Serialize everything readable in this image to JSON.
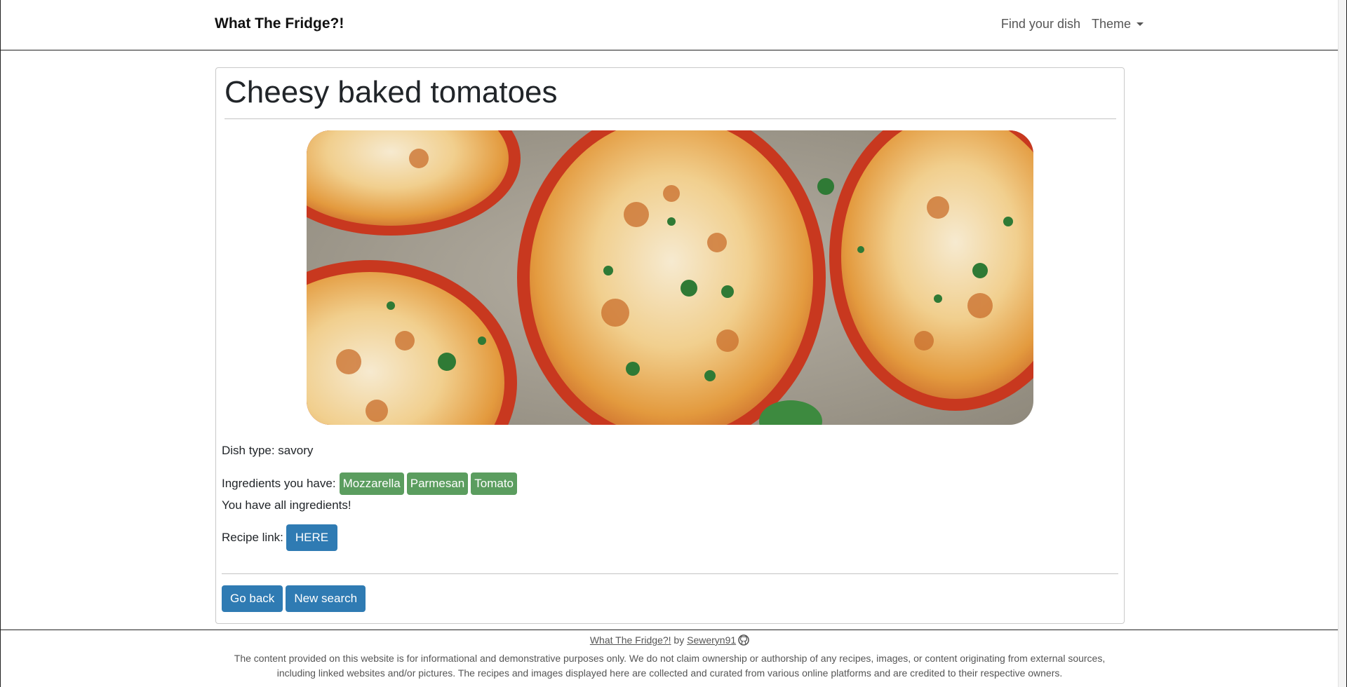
{
  "navbar": {
    "brand": "What The Fridge?!",
    "links": {
      "find": "Find your dish",
      "theme": "Theme"
    }
  },
  "recipe": {
    "title": "Cheesy baked tomatoes",
    "image_alt": "Cheesy baked tomatoes",
    "dish_type": "Dish type: savory",
    "ingredients_label": "Ingredients you have:",
    "ingredients": [
      "Mozzarella",
      "Parmesan",
      "Tomato"
    ],
    "all_ingredients_text": "You have all ingredients!",
    "recipe_link_label": "Recipe link:",
    "recipe_link_button": "HERE"
  },
  "actions": {
    "go_back": "Go back",
    "new_search": "New search"
  },
  "footer": {
    "app_name": "What The Fridge?!",
    "by": "by",
    "author": "Seweryn91",
    "disclaimer_line1": "The content provided on this website is for informational and demonstrative purposes only. We do not claim ownership or authorship of any recipes, images, or content originating from external sources,",
    "disclaimer_line2": "including linked websites and/or pictures. The recipes and images displayed here are collected and curated from various online platforms and are credited to their respective owners."
  },
  "colors": {
    "badge_green": "#5b9d5f",
    "button_blue": "#2f7bb3"
  }
}
